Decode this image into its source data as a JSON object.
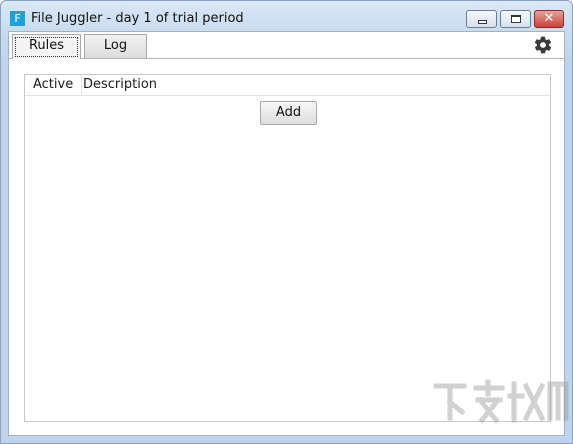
{
  "window": {
    "title": "File Juggler - day 1 of trial period",
    "app_icon_letter": "F"
  },
  "titlebar_buttons": {
    "minimize_icon": "minimize-icon",
    "maximize_icon": "maximize-icon",
    "close_icon": "close-icon",
    "close_glyph": "✕"
  },
  "tabs": [
    {
      "label": "Rules",
      "selected": true
    },
    {
      "label": "Log",
      "selected": false
    }
  ],
  "settings": {
    "icon": "gear-icon"
  },
  "rules_table": {
    "columns": [
      "Active",
      "Description"
    ],
    "rows": []
  },
  "add_button": {
    "label": "Add"
  }
}
